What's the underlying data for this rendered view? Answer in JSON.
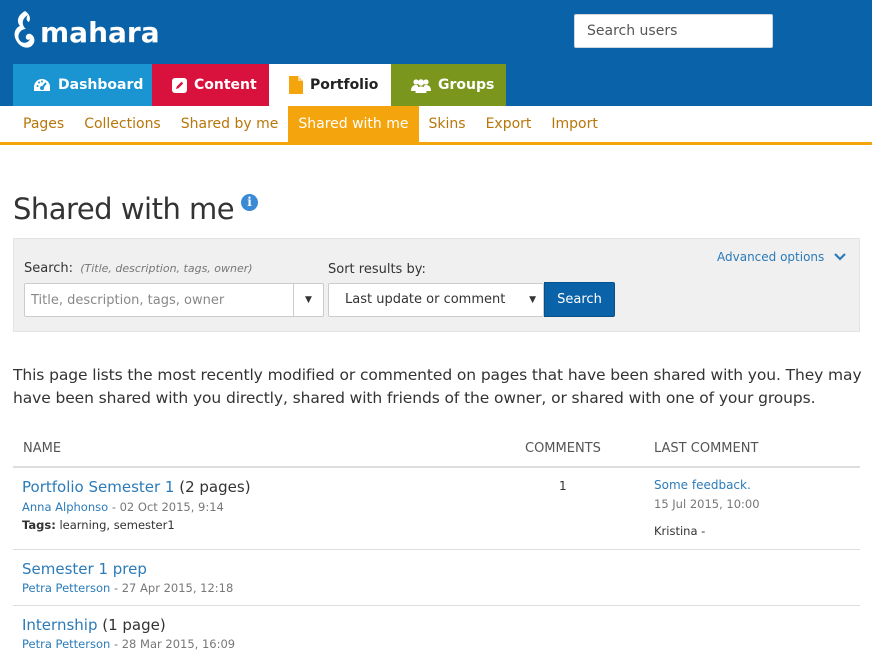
{
  "brand": {
    "name": "mahara",
    "header_color": "#0a63a8"
  },
  "header": {
    "search_placeholder": "Search users"
  },
  "main_nav": {
    "tabs": [
      {
        "label": "Dashboard",
        "icon": "dashboard-gauge-icon",
        "color": "#1a95d2"
      },
      {
        "label": "Content",
        "icon": "pencil-square-icon",
        "color": "#d9123d"
      },
      {
        "label": "Portfolio",
        "icon": "file-icon",
        "color": "#f4a50e",
        "active": true
      },
      {
        "label": "Groups",
        "icon": "users-icon",
        "color": "#7b961d"
      }
    ]
  },
  "sub_nav": {
    "items": [
      {
        "label": "Pages"
      },
      {
        "label": "Collections"
      },
      {
        "label": "Shared by me"
      },
      {
        "label": "Shared with me",
        "active": true
      },
      {
        "label": "Skins"
      },
      {
        "label": "Export"
      },
      {
        "label": "Import"
      }
    ],
    "accent": "#f4a50e"
  },
  "page": {
    "title": "Shared with me",
    "info_icon": "i"
  },
  "search_panel": {
    "label": "Search:",
    "label_hint": "(Title, description, tags, owner)",
    "input_placeholder": "Title, description, tags, owner",
    "dropdown_caret": "▼",
    "sort_label": "Sort results by:",
    "sort_value": "Last update or comment",
    "search_button": "Search",
    "advanced_options": "Advanced options"
  },
  "intro_text": "This page lists the most recently modified or commented on pages that have been shared with you. They may have been shared with you directly, shared with friends of the owner, or shared with one of your groups.",
  "table": {
    "headers": {
      "name": "NAME",
      "comments": "COMMENTS",
      "last_comment": "LAST COMMENT"
    },
    "rows": [
      {
        "title": "Portfolio Semester 1",
        "title_suffix": "(2 pages)",
        "owner": "Anna Alphonso",
        "date": "- 02 Oct 2015, 9:14",
        "tags_label": "Tags:",
        "tags": "learning, semester1",
        "comments": "1",
        "last_comment": "Some feedback.",
        "last_comment_date": "15 Jul 2015, 10:00",
        "last_comment_author": "Kristina -"
      },
      {
        "title": "Semester 1 prep",
        "title_suffix": "",
        "owner": "Petra Petterson",
        "date": "- 27 Apr 2015, 12:18"
      },
      {
        "title": "Internship",
        "title_suffix": "(1 page)",
        "owner": "Petra Petterson",
        "date": "- 28 Mar 2015, 16:09"
      }
    ]
  }
}
